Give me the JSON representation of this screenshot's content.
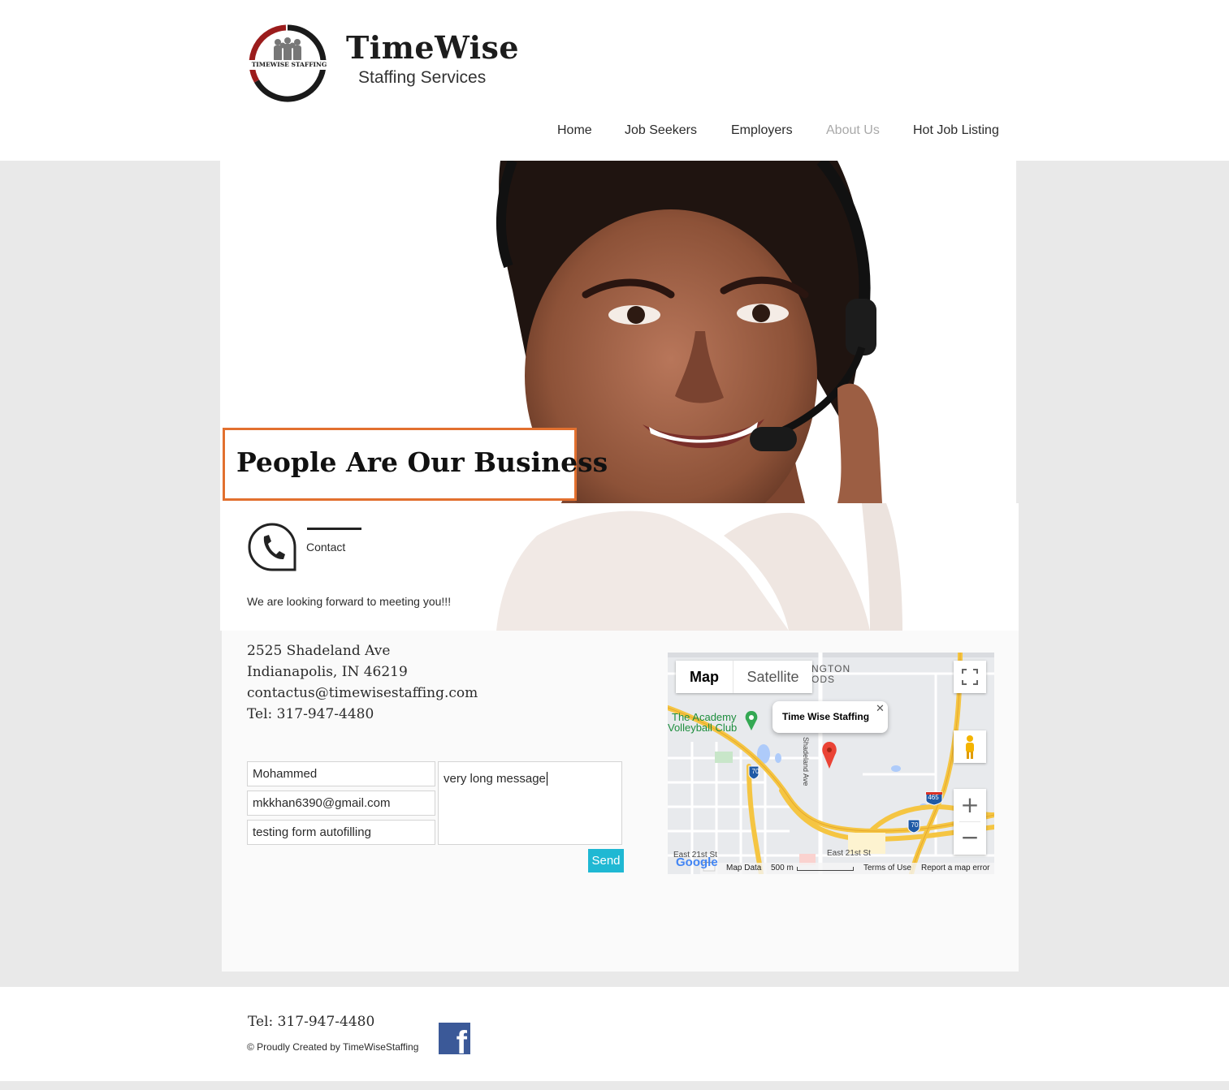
{
  "brand": {
    "logo_text": "TIMEWISE STAFFING",
    "title": "TimeWise",
    "subtitle": "Staffing Services"
  },
  "nav": {
    "items": [
      {
        "label": "Home"
      },
      {
        "label": "Job Seekers"
      },
      {
        "label": "Employers"
      },
      {
        "label": "About Us",
        "active": true
      },
      {
        "label": "Hot Job Listing"
      }
    ]
  },
  "hero": {
    "tagline": "People Are Our Business",
    "accent_color": "#e2702f"
  },
  "contact": {
    "label": "Contact",
    "welcome": "We are looking forward to meeting you!!!",
    "address_line1": "2525 Shadeland Ave",
    "address_line2": "Indianapolis, IN 46219",
    "email": "contactus@timewisestaffing.com",
    "phone": "Tel: 317-947-4480"
  },
  "form": {
    "name_value": "Mohammed",
    "email_value": "mkkhan6390@gmail.com",
    "subject_value": "testing form autofilling",
    "message_value": "very long message",
    "send_label": "Send",
    "send_color": "#1fb8d3"
  },
  "map": {
    "map_tab": "Map",
    "satellite_tab": "Satellite",
    "info_title": "Time Wise Staffing",
    "close_glyph": "✕",
    "place_label_line1": "The Academy",
    "place_label_line2": "Volleyball Club",
    "area_label_line1": "NGTON",
    "area_label_line2": "ODS",
    "street_label": "East 21st St",
    "street_label_left": "East 21st St",
    "road_vertical": "Shadeland Ave",
    "shield_70": "70",
    "shield_465": "465",
    "zoom_in": "+",
    "zoom_out": "−",
    "google_logo": "Google",
    "map_data": "Map Data",
    "scale": "500 m",
    "terms": "Terms of Use",
    "report": "Report a map error"
  },
  "footer": {
    "phone": "Tel: 317-947-4480",
    "copyright": "© Proudly Created by TimeWiseStaffing",
    "facebook_glyph": "f"
  }
}
